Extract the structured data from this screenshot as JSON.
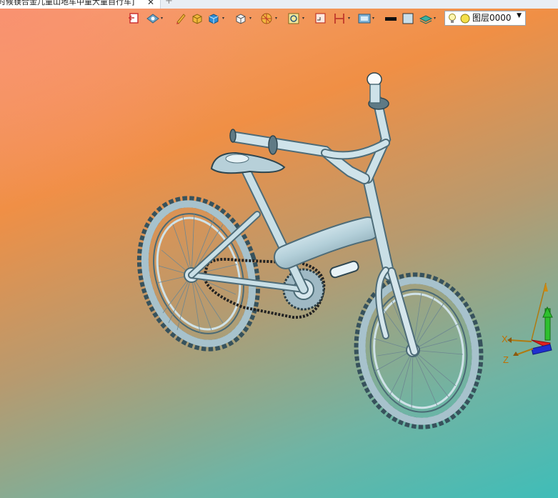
{
  "window": {
    "tab_title": "时候镁合金儿童山地车中童大童自行车]",
    "tab_close": "✕",
    "new_tab": "+"
  },
  "toolbar": {
    "tools": [
      {
        "icon": "exit-sketch-icon",
        "has_dropdown": false
      },
      {
        "icon": "view-orientation-icon",
        "has_dropdown": true
      },
      {
        "icon": "sketch-pencil-icon",
        "has_dropdown": false
      },
      {
        "icon": "shaded-box-icon",
        "has_dropdown": false
      },
      {
        "icon": "shaded-solid-icon",
        "has_dropdown": true
      },
      {
        "icon": "view-cube-icon",
        "has_dropdown": true
      },
      {
        "icon": "display-filter-icon",
        "has_dropdown": true
      },
      {
        "icon": "zoom-fit-icon",
        "has_dropdown": true
      },
      {
        "icon": "section-view-icon",
        "has_dropdown": false
      },
      {
        "icon": "measure-icon",
        "has_dropdown": true
      },
      {
        "icon": "render-settings-icon",
        "has_dropdown": true
      },
      {
        "icon": "line-color-icon",
        "has_dropdown": false
      },
      {
        "icon": "face-color-icon",
        "has_dropdown": false
      },
      {
        "icon": "layer-manager-icon",
        "has_dropdown": true
      }
    ],
    "layer_select": {
      "value": "图层0000",
      "icons": [
        "bulb-icon",
        "layer-status-icon"
      ]
    }
  },
  "axis_triad": {
    "labels": {
      "x": "X",
      "y": "Y",
      "z": "Z"
    },
    "colors": {
      "x": "#e02020",
      "y": "#20c020",
      "z": "#2030d0",
      "label": "#c07000"
    }
  },
  "model": {
    "name": "bicycle-model",
    "color": "#b9d3dd"
  },
  "colors": {
    "toolbar_bg": "#e9eef4",
    "background_top": "#f08f45",
    "background_bottom": "#3fbdb8"
  }
}
